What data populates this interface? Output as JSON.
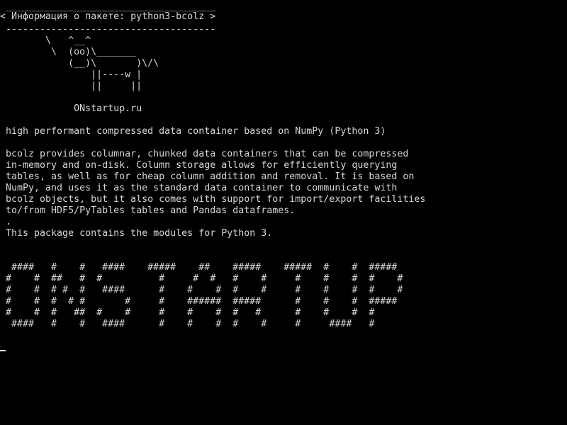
{
  "terminal": {
    "cowsay": {
      "border_top": " _____________________________________",
      "title": "< Информация о пакете: python3-bcolz >",
      "border_bottom": " -------------------------------------",
      "cow": [
        "        \\   ^__^",
        "         \\  (oo)\\_______",
        "            (__)\\       )\\/\\",
        "                ||----w |",
        "                ||     ||"
      ]
    },
    "site": "             ONstartup.ru",
    "short_description": " high performant compressed data container based on NumPy (Python 3)",
    "long_description": [
      " bcolz provides columnar, chunked data containers that can be compressed",
      " in-memory and on-disk. Column storage allows for efficiently querying",
      " tables, as well as for cheap column addition and removal. It is based on",
      " NumPy, and uses it as the standard data container to communicate with",
      " bcolz objects, but it also comes with support for import/export facilities",
      " to/from HDF5/PyTables tables and Pandas dataframes.",
      " .",
      " This package contains the modules for Python 3."
    ],
    "banner": [
      "  ####   #    #   ####    #####    ##    #####    #####  #    #  #####",
      " #    #  ##   #  #          #     #  #   #    #     #    #    #  #    #",
      " #    #  # #  #   ####      #    #    #  #    #     #    #    #  #    #",
      " #    #  #  # #       #     #    ######  #####      #    #    #  #####",
      " #    #  #   ##  #    #     #    #    #  #   #      #    #    #  #",
      "  ####   #    #   ####      #    #    #  #    #     #     ####   #"
    ]
  }
}
